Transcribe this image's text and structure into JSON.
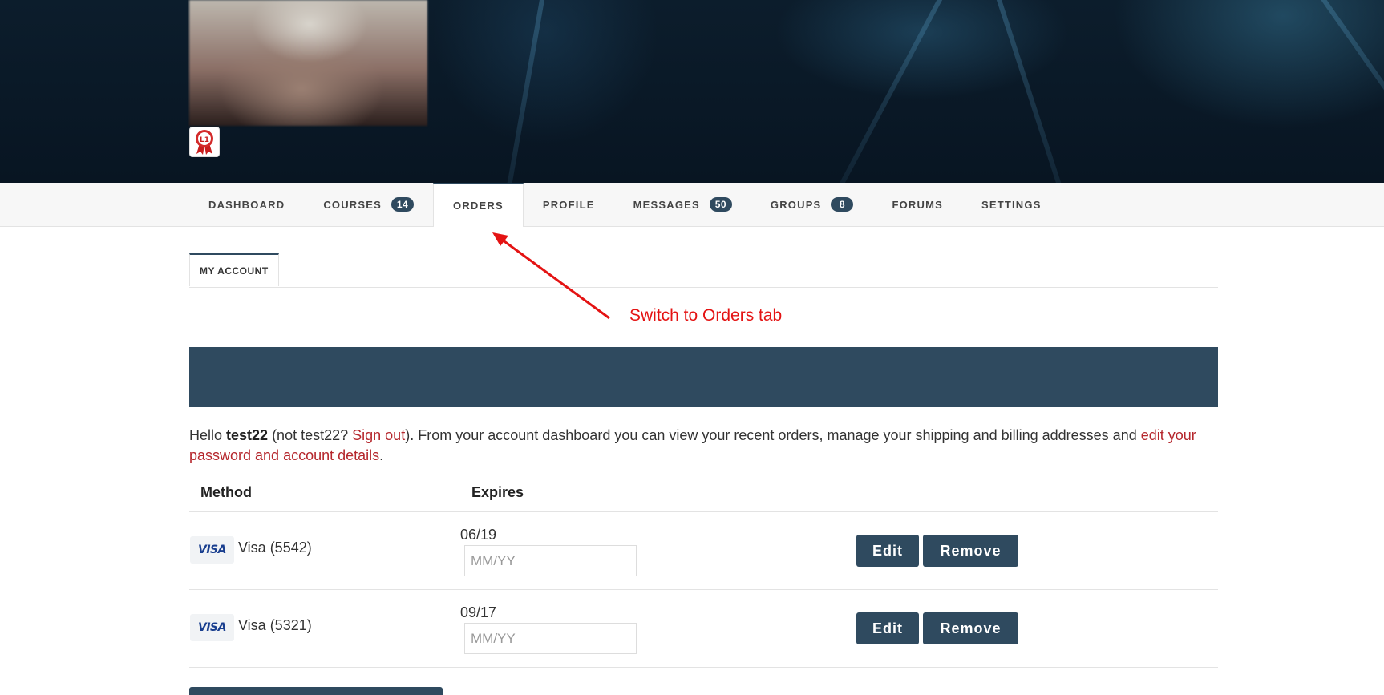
{
  "nav": {
    "items": [
      {
        "label": "DASHBOARD",
        "count": null
      },
      {
        "label": "COURSES",
        "count": "14"
      },
      {
        "label": "ORDERS",
        "count": null
      },
      {
        "label": "PROFILE",
        "count": null
      },
      {
        "label": "MESSAGES",
        "count": "50"
      },
      {
        "label": "GROUPS",
        "count": "8"
      },
      {
        "label": "FORUMS",
        "count": null
      },
      {
        "label": "SETTINGS",
        "count": null
      }
    ],
    "active": "ORDERS"
  },
  "subtabs": {
    "my_account": "MY ACCOUNT"
  },
  "annotation": {
    "text": "Switch to Orders tab",
    "color": "#e41313"
  },
  "intro": {
    "hello": "Hello ",
    "username": "test22",
    "not_open": " (not test22? ",
    "sign_out": "Sign out",
    "body": "). From your account dashboard you can view your recent orders, manage your shipping and billing addresses and ",
    "edit_link": "edit your password and account details",
    "end": "."
  },
  "table": {
    "headers": {
      "method": "Method",
      "expires": "Expires"
    },
    "rows": [
      {
        "logo": "VISA",
        "method": "Visa (5542)",
        "expires": "06/19",
        "placeholder": "MM/YY",
        "edit": "Edit",
        "remove": "Remove"
      },
      {
        "logo": "VISA",
        "method": "Visa (5321)",
        "expires": "09/17",
        "placeholder": "MM/YY",
        "edit": "Edit",
        "remove": "Remove"
      }
    ]
  },
  "colors": {
    "accent": "#2f4a5f",
    "link": "#b5262c",
    "annotation": "#e41313"
  }
}
